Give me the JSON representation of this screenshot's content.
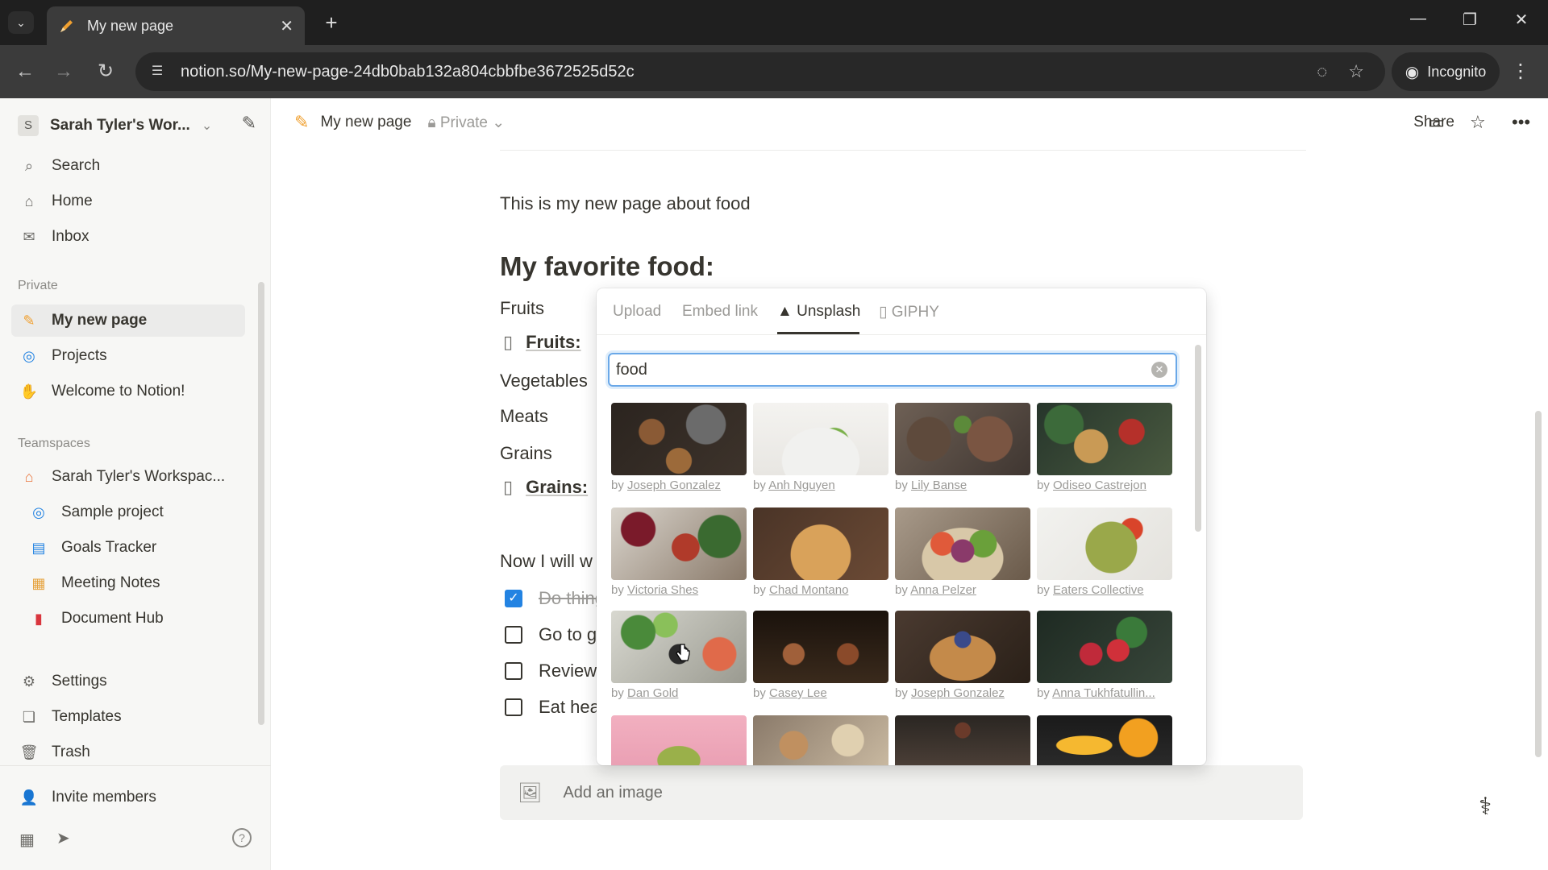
{
  "browser": {
    "tab_title": "My new page",
    "url": "notion.so/My-new-page-24db0bab132a804cbbfbe3672525d52c",
    "incognito_label": "Incognito"
  },
  "sidebar": {
    "workspace_initial": "S",
    "workspace_name": "Sarah Tyler's Wor...",
    "top_items": [
      {
        "label": "Search",
        "icon": "search-icon"
      },
      {
        "label": "Home",
        "icon": "home-icon"
      },
      {
        "label": "Inbox",
        "icon": "inbox-icon"
      }
    ],
    "private_label": "Private",
    "private_items": [
      {
        "label": "My new page",
        "icon": "pencil-emoji-icon"
      },
      {
        "label": "Projects",
        "icon": "projects-icon"
      },
      {
        "label": "Welcome to Notion!",
        "icon": "wave-emoji-icon"
      }
    ],
    "teamspaces_label": "Teamspaces",
    "teamspace_name": "Sarah Tyler's Workspac...",
    "teamspace_items": [
      {
        "label": "Sample project",
        "icon": "projects-icon"
      },
      {
        "label": "Goals Tracker",
        "icon": "chart-icon"
      },
      {
        "label": "Meeting Notes",
        "icon": "calendar-icon"
      },
      {
        "label": "Document Hub",
        "icon": "document-icon"
      }
    ],
    "bottom_items": [
      {
        "label": "Settings",
        "icon": "gear-icon"
      },
      {
        "label": "Templates",
        "icon": "templates-icon"
      },
      {
        "label": "Trash",
        "icon": "trash-icon"
      }
    ],
    "invite_label": "Invite members"
  },
  "topbar": {
    "breadcrumb": "My new page",
    "privacy": "Private",
    "share_label": "Share"
  },
  "page": {
    "intro": "This is my new page about food",
    "heading": "My favorite food:",
    "fruits_label": "Fruits",
    "fruits_doc": "Fruits:",
    "vegetables_label": "Vegetables",
    "meats_label": "Meats",
    "grains_label": "Grains",
    "grains_doc": "Grains:",
    "now_text": "Now I will w",
    "todos": [
      {
        "label": "Do thing",
        "checked": true
      },
      {
        "label": "Go to gr",
        "checked": false
      },
      {
        "label": "Review t",
        "checked": false
      },
      {
        "label": "Eat heal",
        "checked": false
      }
    ],
    "add_image_label": "Add an image"
  },
  "picker": {
    "tabs": [
      "Upload",
      "Embed link",
      "Unsplash",
      "GIPHY"
    ],
    "active_tab": "Unsplash",
    "search_value": "food",
    "photos": [
      {
        "by": "by",
        "author": "Joseph Gonzalez"
      },
      {
        "by": "by",
        "author": "Anh Nguyen"
      },
      {
        "by": "by",
        "author": "Lily Banse"
      },
      {
        "by": "by",
        "author": "Odiseo Castrejon"
      },
      {
        "by": "by",
        "author": "Victoria Shes"
      },
      {
        "by": "by",
        "author": "Chad Montano"
      },
      {
        "by": "by",
        "author": "Anna Pelzer"
      },
      {
        "by": "by",
        "author": "Eaters Collective"
      },
      {
        "by": "by",
        "author": "Dan Gold"
      },
      {
        "by": "by",
        "author": "Casey Lee"
      },
      {
        "by": "by",
        "author": "Joseph Gonzalez"
      },
      {
        "by": "by",
        "author": "Anna Tukhfatullin..."
      }
    ],
    "colors": {
      "accent": "#2383e2"
    }
  }
}
